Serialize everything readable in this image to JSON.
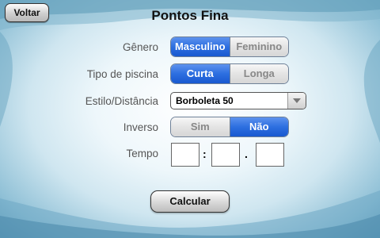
{
  "header": {
    "back_label": "Voltar",
    "title": "Pontos Fina"
  },
  "form": {
    "genero": {
      "label": "Gênero",
      "options": [
        "Masculino",
        "Feminino"
      ],
      "selected": "Masculino"
    },
    "tipo_piscina": {
      "label": "Tipo de piscina",
      "options": [
        "Curta",
        "Longa"
      ],
      "selected": "Curta"
    },
    "estilo_distancia": {
      "label": "Estilo/Distância",
      "value": "Borboleta 50"
    },
    "inverso": {
      "label": "Inverso",
      "options": [
        "Sim",
        "Não"
      ],
      "selected": "Não"
    },
    "tempo": {
      "label": "Tempo",
      "separator_1": ":",
      "separator_2": ".",
      "minutes": "",
      "seconds": "",
      "hundredths": ""
    },
    "calc_label": "Calcular"
  },
  "colors": {
    "selected_segment": "#2d6fe0",
    "unselected_segment": "#e4e4e4",
    "label_text": "#555555"
  }
}
